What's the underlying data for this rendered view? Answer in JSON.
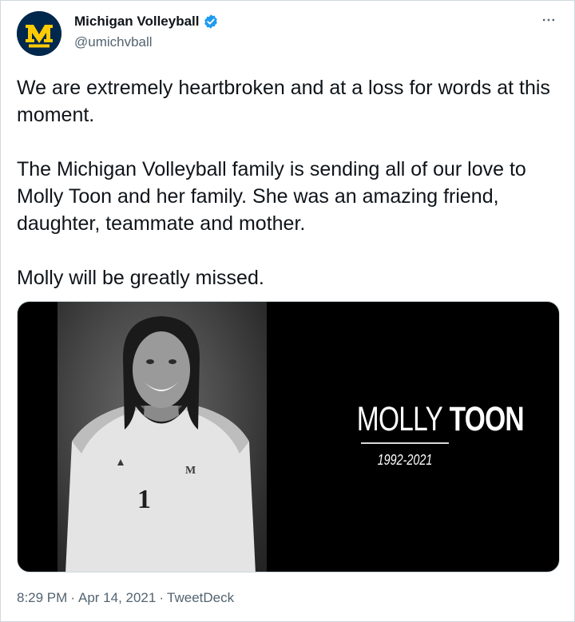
{
  "tweet": {
    "author": {
      "display_name": "Michigan Volleyball",
      "handle": "@umichvball",
      "verified": true,
      "avatar_letter": "M",
      "avatar_caption": "VOLLEYBALL"
    },
    "paragraphs": [
      "We are extremely heartbroken and at a loss for words at this moment.",
      "The Michigan Volleyball family is sending all of our love to Molly Toon and her family.  She was an amazing friend, daughter, teammate and mother.",
      "Molly will be greatly missed."
    ],
    "media": {
      "name_first": "MOLLY",
      "name_last": "TOON",
      "years": "1992-2021",
      "jersey_number": "1",
      "jersey_logo": "M"
    },
    "time": "8:29 PM",
    "date": "Apr 14, 2021",
    "source": "TweetDeck",
    "separator": "·",
    "more_icon": "more-horizontal-icon",
    "colors": {
      "brand_navy": "#00274c",
      "brand_maize": "#ffcb05",
      "verified_blue": "#1d9bf0",
      "muted_text": "#536471"
    }
  }
}
